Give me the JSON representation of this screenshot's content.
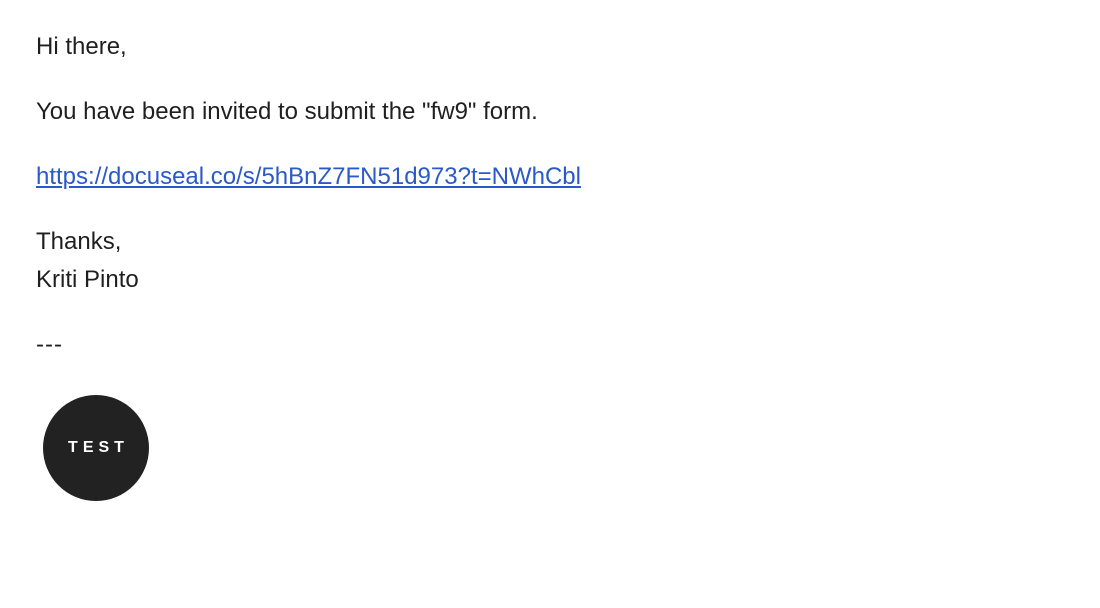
{
  "email": {
    "greeting": "Hi there,",
    "body": "You have been invited to submit the \"fw9\" form.",
    "link": "https://docuseal.co/s/5hBnZ7FN51d973?t=NWhCbl",
    "closing": "Thanks,",
    "sender_name": "Kriti Pinto",
    "divider": "---"
  },
  "logo": {
    "text": "TEST",
    "background_color": "#222222",
    "text_color": "#ffffff"
  },
  "colors": {
    "text": "#1f1f1f",
    "link": "#2a59c9",
    "background": "#ffffff"
  }
}
